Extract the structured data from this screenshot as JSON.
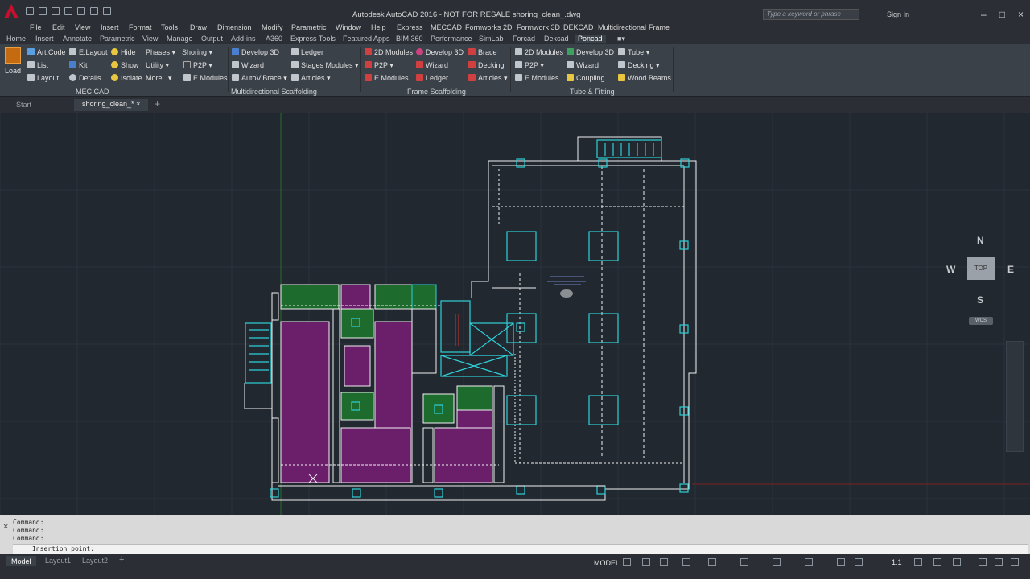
{
  "app": {
    "title": "Autodesk AutoCAD 2016 - NOT FOR RESALE    shoring_clean_.dwg",
    "search_placeholder": "Type a keyword or phrase",
    "signin": "Sign In"
  },
  "menu": [
    "File",
    "Edit",
    "View",
    "Insert",
    "Format",
    "Tools",
    "Draw",
    "Dimension",
    "Modify",
    "Parametric",
    "Window",
    "Help",
    "Express",
    "MECCAD",
    "Formworks 2D",
    "Formwork 3D",
    "DEKCAD",
    "Multidirectional",
    "Frame"
  ],
  "ribbon_tabs": [
    "Home",
    "Insert",
    "Annotate",
    "Parametric",
    "View",
    "Manage",
    "Output",
    "Add-ins",
    "A360",
    "Express Tools",
    "Featured Apps",
    "BIM 360",
    "Performance",
    "SimLab",
    "Forcad",
    "Dekcad",
    "Poncad"
  ],
  "ribbon_active_tab": "Poncad",
  "ribbon": {
    "load": "Load",
    "mec": [
      "Art.Code",
      "E.Layout",
      "Hide",
      "Phases",
      "Shoring",
      "List",
      "Kit",
      "Show",
      "Utility",
      "P2P",
      "Layout",
      "Details",
      "Isolate",
      "More..",
      "E.Modules"
    ],
    "multi": [
      "Develop 3D",
      "Ledger",
      "Wizard",
      "Stages Modules",
      "AutoV.Brace",
      "Articles"
    ],
    "frame": [
      "2D Modules",
      "Develop 3D",
      "Brace",
      "P2P",
      "Wizard",
      "Decking",
      "E.Modules",
      "Ledger",
      "Articles"
    ],
    "tube": [
      "2D Modules",
      "Develop 3D",
      "Tube",
      "P2P",
      "Wizard",
      "Decking",
      "E.Modules",
      "Coupling",
      "Wood Beams"
    ],
    "panels": [
      "MEC CAD",
      "Multidirectional Scaffolding",
      "Frame Scaffolding",
      "Tube & Fitting"
    ]
  },
  "doc_tabs": [
    "Start",
    "shoring_clean_*"
  ],
  "viewcube": {
    "n": "N",
    "s": "S",
    "e": "E",
    "w": "W",
    "top": "TOP",
    "wcs": "WCS"
  },
  "command": {
    "history": [
      "Command:",
      "Command:",
      "Command:"
    ],
    "prompt": "Insertion point:"
  },
  "layout_tabs": [
    "Model",
    "Layout1",
    "Layout2"
  ],
  "status": {
    "model": "MODEL",
    "scale": "1:1"
  },
  "colors": {
    "bg": "#212830",
    "green": "#1e6b2e",
    "purple": "#6b1f6b",
    "cyan": "#2fd0d8",
    "white": "#f0f0f0"
  }
}
